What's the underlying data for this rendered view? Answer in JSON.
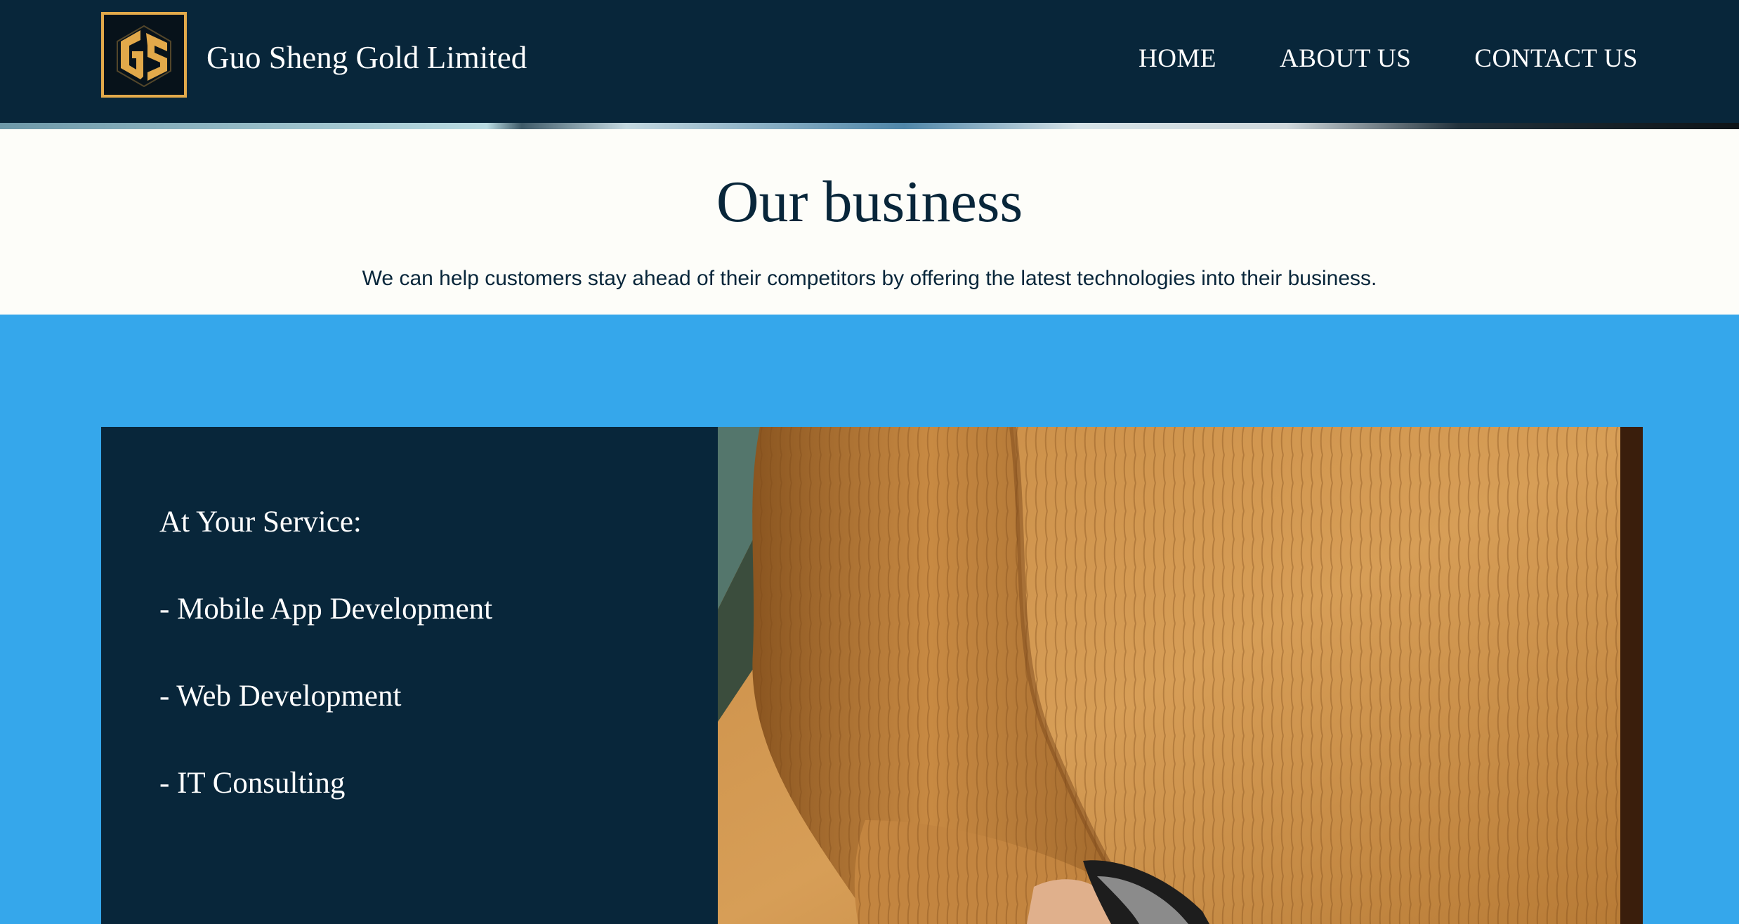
{
  "header": {
    "logo_text": "GS",
    "brand_name": "Guo Sheng Gold Limited",
    "nav": [
      {
        "label": "HOME"
      },
      {
        "label": "ABOUT US"
      },
      {
        "label": "CONTACT US"
      }
    ]
  },
  "intro": {
    "title": "Our business",
    "subtitle": "We can help customers stay ahead of their competitors by offering the latest technologies into their business."
  },
  "services": {
    "heading": "At Your Service:",
    "items": [
      "- Mobile App Development",
      "- Web Development",
      "- IT Consulting"
    ]
  },
  "colors": {
    "navy": "#08263a",
    "gold": "#e2a94a",
    "blue": "#35a7eb",
    "cream": "#fdfdf9"
  },
  "icons": {
    "logo": "gs-monogram-icon",
    "photo": "sweater-photo"
  }
}
